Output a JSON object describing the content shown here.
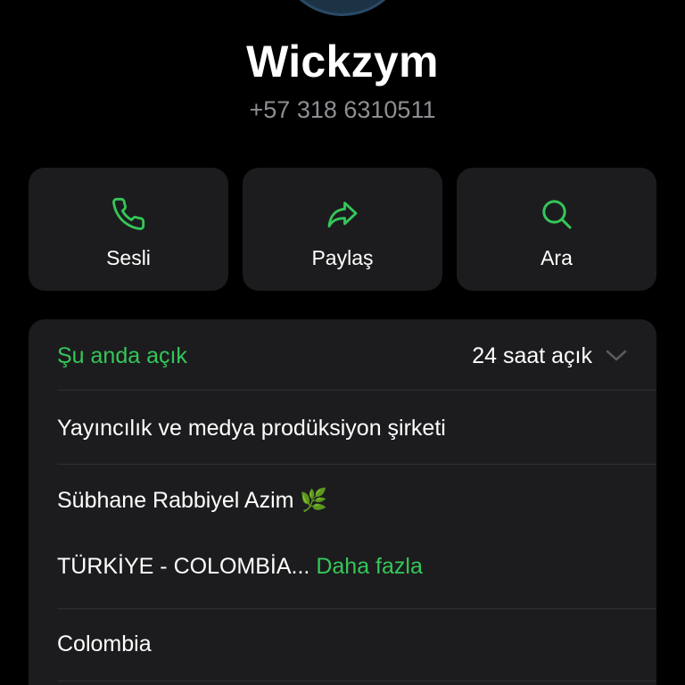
{
  "contact": {
    "name": "Wickzym",
    "phone": "+57 318 6310511"
  },
  "actions": [
    {
      "label": "Sesli",
      "icon": "phone-icon"
    },
    {
      "label": "Paylaş",
      "icon": "share-arrow-icon"
    },
    {
      "label": "Ara",
      "icon": "search-icon"
    }
  ],
  "hours": {
    "status": "Şu anda açık",
    "detail": "24 saat açık",
    "icon": "chevron-down-icon"
  },
  "business": {
    "category": "Yayıncılık ve medya prodüksiyon şirketi",
    "description_line1": "Sübhane Rabbiyel Azim 🌿",
    "description_line2": "TÜRKİYE - COLOMBİA...",
    "more_link": "Daha fazla",
    "location": "Colombia"
  },
  "colors": {
    "accent": "#34c759",
    "background": "#000000",
    "card": "#1c1c1e",
    "secondary_text": "#8e8e93"
  }
}
